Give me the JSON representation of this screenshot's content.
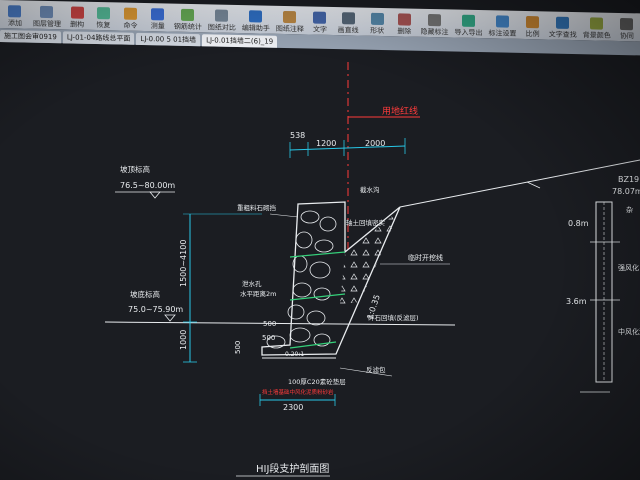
{
  "toolbar": {
    "buttons": [
      {
        "label": "添加",
        "icon": "add-icon",
        "color": "#4a7cc7"
      },
      {
        "label": "图层管理",
        "icon": "layers-icon",
        "color": "#6f8db8"
      },
      {
        "label": "删构",
        "icon": "delete-icon",
        "color": "#c44"
      },
      {
        "label": "恢复",
        "icon": "restore-icon",
        "color": "#5b9"
      },
      {
        "label": "命令",
        "icon": "command-icon",
        "color": "#d93"
      },
      {
        "label": "测量",
        "icon": "measure-icon",
        "color": "#3a6fd8"
      },
      {
        "label": "钢筋统计",
        "icon": "rebar-icon",
        "color": "#6a5"
      },
      {
        "label": "图纸对比",
        "icon": "compare-icon",
        "color": "#789"
      },
      {
        "label": "编辑助手",
        "icon": "edit-icon",
        "color": "#2f6fc4"
      },
      {
        "label": "图纸注释",
        "icon": "note-icon",
        "color": "#b84"
      },
      {
        "label": "文字",
        "icon": "text-icon",
        "color": "#46a"
      },
      {
        "label": "画直线",
        "icon": "line-icon",
        "color": "#567"
      },
      {
        "label": "形状",
        "icon": "shape-icon",
        "color": "#58a"
      },
      {
        "label": "删除",
        "icon": "erase-icon",
        "color": "#a55"
      },
      {
        "label": "隐藏标注",
        "icon": "hide-icon",
        "color": "#777"
      },
      {
        "label": "导入导出",
        "icon": "import-icon",
        "color": "#3a8"
      },
      {
        "label": "标注设置",
        "icon": "settings-icon",
        "color": "#48c"
      },
      {
        "label": "比例",
        "icon": "scale-icon",
        "color": "#c83"
      },
      {
        "label": "文字查找",
        "icon": "find-icon",
        "color": "#37b"
      },
      {
        "label": "背景颜色",
        "icon": "bg-color-icon",
        "color": "#9a4"
      },
      {
        "label": "协同",
        "icon": "collab-icon",
        "color": "#666"
      }
    ],
    "title": "施工图会审0919"
  },
  "tabs": [
    {
      "label": "LJ-01-04路线总平面",
      "active": false
    },
    {
      "label": "LJ-0.00 5 01挡墙",
      "active": false
    },
    {
      "label": "LJ-0.01挡墙二(6)_19",
      "active": true
    }
  ],
  "drawing": {
    "redline_label": "用地红线",
    "dim_top": [
      "538",
      "1200",
      "2000"
    ],
    "left_labels": [
      {
        "title": "坡顶标高",
        "value": "76.5~80.00m"
      },
      {
        "title": "坡底标高",
        "value": "75.0~75.90m"
      }
    ],
    "vertical_dims": [
      "1500~4100",
      "1000"
    ],
    "wall_labels": {
      "top_left": "重粗料石砌挡",
      "top_right": "截水沟",
      "inner": "轴土回填密实",
      "excavation": "临时开挖线",
      "slope": "1:0.35",
      "drain": "泄水孔",
      "drain_sub": "水平距离2m",
      "gravel": "碎石回填(反滤层)",
      "filter": "反滤包",
      "base": "100厚C20素砼垫层",
      "base_ratio": "0.20:1",
      "red_note": "挡土墙基础中风化泥质粉砂岩",
      "dim_500a": "500",
      "dim_500b": "500",
      "dim_500c": "500"
    },
    "bottom_dim": "2300",
    "drawing_title": "HIJ段支护剖面图",
    "borehole": {
      "id": "BZ19",
      "elev": "78.07m",
      "depth1": "0.8m",
      "depth2": "3.6m",
      "layer1": "强风化",
      "layer2": "中风化泥",
      "layer3": "杂"
    }
  },
  "colors": {
    "cad_bg": "#1b1d22",
    "white": "#e9ecef",
    "cyan": "#28c8e8",
    "red": "#ff3b3b",
    "green": "#35d07a"
  }
}
